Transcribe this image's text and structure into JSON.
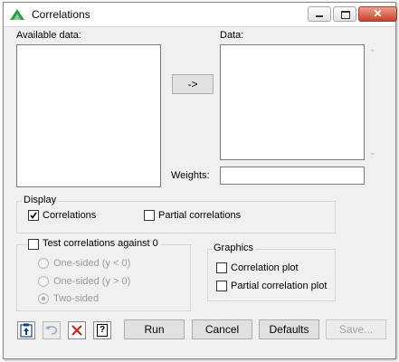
{
  "window": {
    "title": "Correlations",
    "close_glyph": "✕"
  },
  "available_data": {
    "label": "Available data:"
  },
  "move_button": {
    "label": "->"
  },
  "data_list": {
    "label": "Data:"
  },
  "weights": {
    "label": "Weights:",
    "value": ""
  },
  "display": {
    "legend": "Display",
    "correlations": {
      "label": "Correlations",
      "checked": true
    },
    "partial_correlations": {
      "label": "Partial correlations",
      "checked": false
    }
  },
  "test": {
    "label": "Test correlations against 0",
    "checked": false,
    "options": [
      "One-sided (y < 0)",
      "One-sided (y > 0)",
      "Two-sided"
    ],
    "selected": "Two-sided"
  },
  "graphics": {
    "legend": "Graphics",
    "correlation_plot": {
      "label": "Correlation plot",
      "checked": false
    },
    "partial_correlation_plot": {
      "label": "Partial correlation plot",
      "checked": false
    }
  },
  "footer": {
    "run": "Run",
    "cancel": "Cancel",
    "defaults": "Defaults",
    "save": "Save...",
    "help_glyph": "?"
  },
  "colors": {
    "accent_green": "#2e9a4a",
    "close_red": "#c8402a"
  }
}
